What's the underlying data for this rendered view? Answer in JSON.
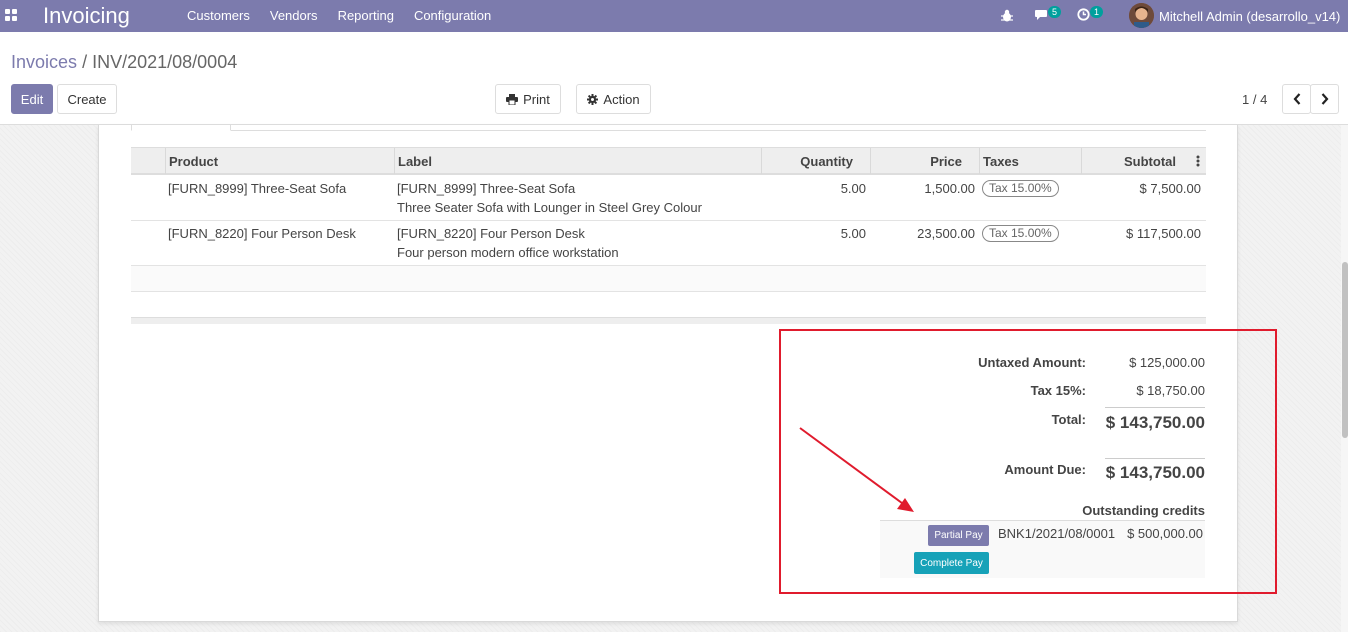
{
  "navbar": {
    "app_name": "Invoicing",
    "menu": [
      "Customers",
      "Vendors",
      "Reporting",
      "Configuration"
    ],
    "messages_count": "5",
    "activities_count": "1",
    "user": "Mitchell Admin (desarrollo_v14)",
    "icons": [
      "apps-grid-icon",
      "bug-icon",
      "chat-icon",
      "activity-clock-icon",
      "avatar"
    ]
  },
  "breadcrumb": {
    "parent": "Invoices",
    "separator": "/",
    "current": "INV/2021/08/0004"
  },
  "toolbar": {
    "edit": "Edit",
    "create": "Create",
    "print": "Print",
    "action": "Action"
  },
  "pager": {
    "value": "1 / 4"
  },
  "table": {
    "headers": [
      "Product",
      "Label",
      "Quantity",
      "Price",
      "Taxes",
      "Subtotal"
    ],
    "rows": [
      {
        "product": "[FURN_8999] Three-Seat Sofa",
        "label_line1": "[FURN_8999] Three-Seat Sofa",
        "label_line2": "Three Seater Sofa with Lounger in Steel Grey Colour",
        "quantity": "5.00",
        "price": "1,500.00",
        "tax": "Tax 15.00%",
        "subtotal": "$ 7,500.00"
      },
      {
        "product": "[FURN_8220] Four Person Desk",
        "label_line1": "[FURN_8220] Four Person Desk",
        "label_line2": "Four person modern office workstation",
        "quantity": "5.00",
        "price": "23,500.00",
        "tax": "Tax 15.00%",
        "subtotal": "$ 117,500.00"
      }
    ]
  },
  "totals": {
    "untaxed_label": "Untaxed Amount:",
    "untaxed_value": "$ 125,000.00",
    "tax_label": "Tax 15%:",
    "tax_value": "$ 18,750.00",
    "total_label": "Total:",
    "total_value": "$ 143,750.00",
    "due_label": "Amount Due:",
    "due_value": "$ 143,750.00",
    "credits_title": "Outstanding credits",
    "credit_ref": "BNK1/2021/08/0001",
    "credit_amount": "$ 500,000.00",
    "partial_pay": "Partial Pay",
    "complete_pay": "Complete Pay"
  },
  "colors": {
    "brand": "#7c7bad",
    "highlight": "#e01b2d",
    "complete_pay": "#17a2b8",
    "partial_pay": "#7c7bad"
  }
}
